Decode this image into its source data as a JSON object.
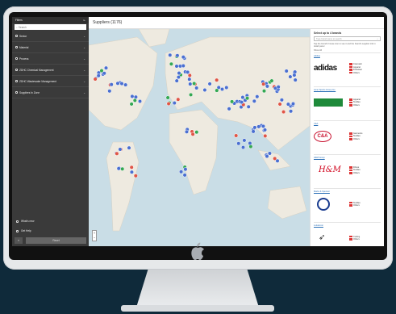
{
  "sidebar": {
    "filters_label": "Filters",
    "search_placeholder": "Search",
    "items": [
      {
        "label": "Sector"
      },
      {
        "label": "Material"
      },
      {
        "label": "Process"
      },
      {
        "label": "ZDHC Chemical Management"
      },
      {
        "label": "ZDHC Wastewater Management"
      },
      {
        "label": "Suppliers In Zone"
      }
    ],
    "whats_new": "What's new",
    "get_help": "Get Help",
    "reset_label": "Reset"
  },
  "header": {
    "title": "Suppliers (1176)"
  },
  "map": {
    "zoom_in": "+",
    "zoom_out": "−"
  },
  "panel": {
    "title": "Select up to 4 brands",
    "input_placeholder": "Type brand name to search",
    "note": "Tap the brand's house icon to see it and the brand's supplier info in detail panel",
    "count": "Show All",
    "brands": [
      {
        "name": "Adidas",
        "logo": "adidas",
        "stats": [
          "Cosmetic",
          "Apparel",
          "Footwear",
          "Others"
        ]
      },
      {
        "name": "Amer Sports Group Inc.",
        "logo": "green-banner",
        "stats": [
          "Apparel",
          "Textiles",
          "Others"
        ]
      },
      {
        "name": "C&A",
        "logo": "c-and-a",
        "stats": [
          "Garments",
          "Textiles",
          "Others"
        ]
      },
      {
        "name": "H&M Group",
        "logo": "h-and-m",
        "stats": [
          "Fibres",
          "Textiles",
          "Others"
        ]
      },
      {
        "name": "Marks & Spencer",
        "logo": "circle-emblem",
        "stats": [
          "Textiles",
          "Others"
        ]
      },
      {
        "name": "Lululemon",
        "logo": "bird",
        "stats": [
          "Cutting",
          "Others"
        ]
      }
    ]
  },
  "colors": {
    "sidebar_bg": "#3a3a3a",
    "map_water": "#c9dde6",
    "map_land": "#eeeae0",
    "marker_blue": "#4a6fd1",
    "marker_green": "#34a853",
    "marker_red": "#e05546",
    "link": "#2a6fb6"
  }
}
